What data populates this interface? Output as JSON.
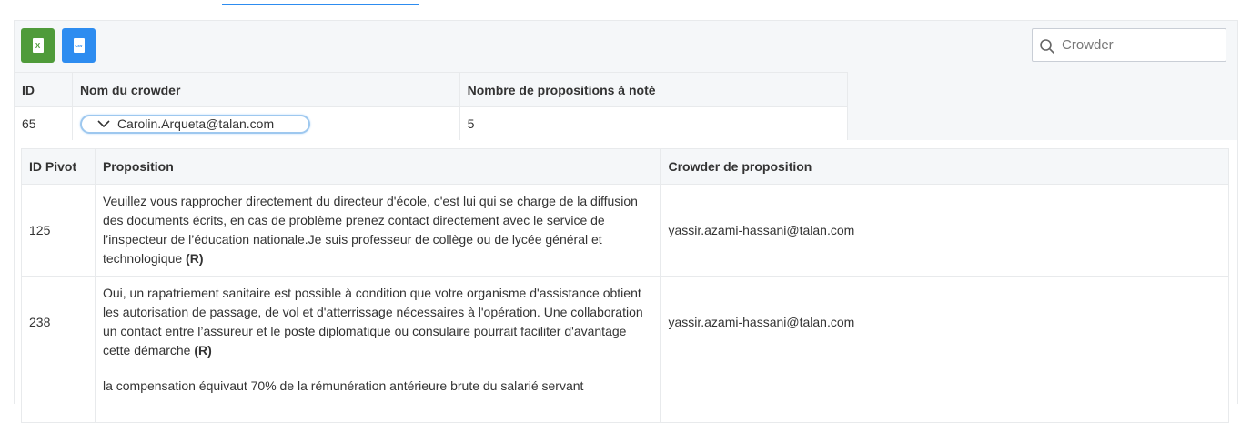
{
  "toolbar": {
    "excel_icon_text": "X",
    "csv_icon_text": "csv"
  },
  "search": {
    "placeholder": "Crowder",
    "value": ""
  },
  "main_table": {
    "headers": [
      "ID",
      "Nom du crowder",
      "Nombre de propositions à noté"
    ],
    "row": {
      "id": "65",
      "crowder": "Carolin.Arqueta@talan.com",
      "count": "5"
    }
  },
  "sub_table": {
    "headers": [
      "ID Pivot",
      "Proposition",
      "Crowder de proposition"
    ],
    "rows": [
      {
        "id": "125",
        "proposition": "Veuillez vous rapprocher directement du directeur d'école, c'est lui qui se charge de la diffusion des documents écrits, en cas de problème prenez contact directement avec le service de l’inspecteur de l’éducation nationale.Je suis professeur de collège ou de lycée général et technologique",
        "tag": "(R)",
        "crowder": "yassir.azami-hassani@talan.com"
      },
      {
        "id": "238",
        "proposition": "Oui, un rapatriement sanitaire est possible à condition que votre organisme d'assistance obtient les autorisation de passage, de vol et d'atterrissage nécessaires à l'opération. Une collaboration un contact entre l’assureur et le poste diplomatique ou consulaire pourrait faciliter d'avantage cette démarche",
        "tag": "(R)",
        "crowder": "yassir.azami-hassani@talan.com"
      },
      {
        "id": "",
        "proposition": "la compensation équivaut 70% de la rémunération antérieure brute du salarié servant",
        "tag": "",
        "crowder": ""
      }
    ]
  },
  "colors": {
    "accent": "#2d8cf0",
    "excel_green": "#4f9b3a",
    "header_bg": "#f5f7f9",
    "border": "#e8eaec"
  },
  "icons": [
    "excel-file-icon",
    "csv-file-icon",
    "search-icon",
    "chevron-down-icon"
  ]
}
